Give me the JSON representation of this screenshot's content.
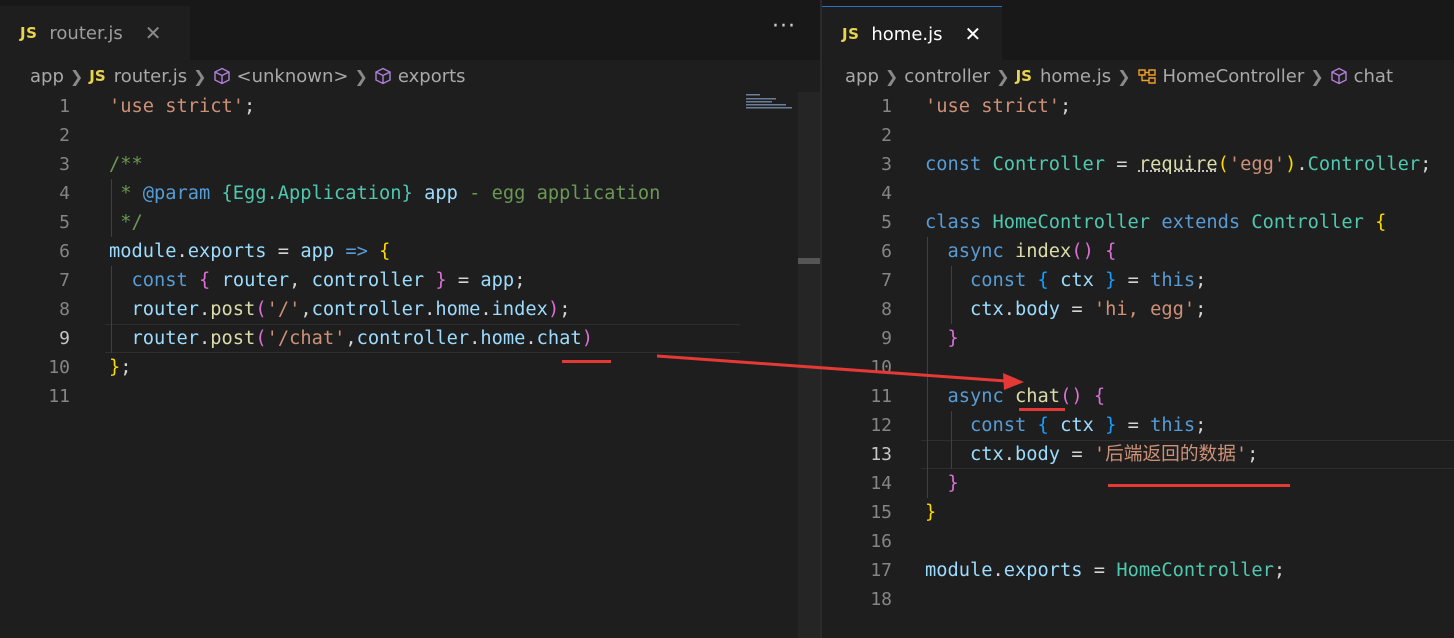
{
  "left_editor": {
    "tab": {
      "icon": "JS",
      "label": "router.js",
      "close": "✕"
    },
    "more": "···",
    "breadcrumb": [
      "app",
      "router.js",
      "<unknown>",
      "exports"
    ],
    "lines": [
      {
        "n": "1",
        "tokens": [
          [
            "str",
            "'use strict'"
          ],
          [
            "t",
            ";"
          ]
        ]
      },
      {
        "n": "2",
        "tokens": []
      },
      {
        "n": "3",
        "tokens": [
          [
            "cmt",
            "/**"
          ]
        ]
      },
      {
        "n": "4",
        "tokens": [
          [
            "cmt",
            " * "
          ],
          [
            "kw",
            "@param"
          ],
          [
            "cmt",
            " "
          ],
          [
            "cls",
            "{Egg.Application}"
          ],
          [
            "cmt",
            " "
          ],
          [
            "var",
            "app"
          ],
          [
            "cmt",
            " - egg application"
          ]
        ]
      },
      {
        "n": "5",
        "tokens": [
          [
            "cmt",
            " */"
          ]
        ]
      },
      {
        "n": "6",
        "tokens": [
          [
            "var",
            "module"
          ],
          [
            "t",
            "."
          ],
          [
            "var",
            "exports"
          ],
          [
            "t",
            " = "
          ],
          [
            "var",
            "app"
          ],
          [
            "t",
            " "
          ],
          [
            "kw",
            "=>"
          ],
          [
            "t",
            " "
          ],
          [
            "b1",
            "{"
          ]
        ]
      },
      {
        "n": "7",
        "tokens": [
          [
            "t",
            "  "
          ],
          [
            "kw",
            "const"
          ],
          [
            "t",
            " "
          ],
          [
            "b2",
            "{"
          ],
          [
            "t",
            " "
          ],
          [
            "var",
            "router"
          ],
          [
            "t",
            ", "
          ],
          [
            "var",
            "controller"
          ],
          [
            "t",
            " "
          ],
          [
            "b2",
            "}"
          ],
          [
            "t",
            " = "
          ],
          [
            "var",
            "app"
          ],
          [
            "t",
            ";"
          ]
        ]
      },
      {
        "n": "8",
        "tokens": [
          [
            "t",
            "  "
          ],
          [
            "var",
            "router"
          ],
          [
            "t",
            "."
          ],
          [
            "fn",
            "post"
          ],
          [
            "b2",
            "("
          ],
          [
            "str",
            "'/'"
          ],
          [
            "t",
            ","
          ],
          [
            "var",
            "controller"
          ],
          [
            "t",
            "."
          ],
          [
            "var",
            "home"
          ],
          [
            "t",
            "."
          ],
          [
            "var",
            "index"
          ],
          [
            "b2",
            ")"
          ],
          [
            "t",
            ";"
          ]
        ]
      },
      {
        "n": "9",
        "tokens": [
          [
            "t",
            "  "
          ],
          [
            "var",
            "router"
          ],
          [
            "t",
            "."
          ],
          [
            "fn",
            "post"
          ],
          [
            "b2",
            "("
          ],
          [
            "str",
            "'/chat'"
          ],
          [
            "t",
            ","
          ],
          [
            "var",
            "controller"
          ],
          [
            "t",
            "."
          ],
          [
            "var",
            "home"
          ],
          [
            "t",
            "."
          ],
          [
            "var",
            "chat"
          ],
          [
            "b2",
            ")"
          ]
        ]
      },
      {
        "n": "10",
        "tokens": [
          [
            "b1",
            "}"
          ],
          [
            "t",
            ";"
          ]
        ]
      },
      {
        "n": "11",
        "tokens": []
      }
    ],
    "current_line": "9"
  },
  "right_editor": {
    "tab": {
      "icon": "JS",
      "label": "home.js",
      "close": "✕"
    },
    "breadcrumb": [
      "app",
      "controller",
      "home.js",
      "HomeController",
      "chat"
    ],
    "lines": [
      {
        "n": "1",
        "tokens": [
          [
            "str",
            "'use strict'"
          ],
          [
            "t",
            ";"
          ]
        ]
      },
      {
        "n": "2",
        "tokens": []
      },
      {
        "n": "3",
        "tokens": [
          [
            "kw",
            "const"
          ],
          [
            "t",
            " "
          ],
          [
            "cls",
            "Controller"
          ],
          [
            "t",
            " = "
          ],
          [
            "fnsq",
            "require"
          ],
          [
            "b1",
            "("
          ],
          [
            "str",
            "'egg'"
          ],
          [
            "b1",
            ")"
          ],
          [
            "t",
            "."
          ],
          [
            "cls",
            "Controller"
          ],
          [
            "t",
            ";"
          ]
        ]
      },
      {
        "n": "4",
        "tokens": []
      },
      {
        "n": "5",
        "tokens": [
          [
            "kw",
            "class"
          ],
          [
            "t",
            " "
          ],
          [
            "cls",
            "HomeController"
          ],
          [
            "t",
            " "
          ],
          [
            "kw",
            "extends"
          ],
          [
            "t",
            " "
          ],
          [
            "cls",
            "Controller"
          ],
          [
            "t",
            " "
          ],
          [
            "b1",
            "{"
          ]
        ]
      },
      {
        "n": "6",
        "tokens": [
          [
            "t",
            "  "
          ],
          [
            "kw",
            "async"
          ],
          [
            "t",
            " "
          ],
          [
            "fn",
            "index"
          ],
          [
            "b2",
            "()"
          ],
          [
            "t",
            " "
          ],
          [
            "b2",
            "{"
          ]
        ]
      },
      {
        "n": "7",
        "tokens": [
          [
            "t",
            "    "
          ],
          [
            "kw",
            "const"
          ],
          [
            "t",
            " "
          ],
          [
            "b3",
            "{"
          ],
          [
            "t",
            " "
          ],
          [
            "var",
            "ctx"
          ],
          [
            "t",
            " "
          ],
          [
            "b3",
            "}"
          ],
          [
            "t",
            " = "
          ],
          [
            "kw",
            "this"
          ],
          [
            "t",
            ";"
          ]
        ]
      },
      {
        "n": "8",
        "tokens": [
          [
            "t",
            "    "
          ],
          [
            "var",
            "ctx"
          ],
          [
            "t",
            "."
          ],
          [
            "var",
            "body"
          ],
          [
            "t",
            " = "
          ],
          [
            "str",
            "'hi, egg'"
          ],
          [
            "t",
            ";"
          ]
        ]
      },
      {
        "n": "9",
        "tokens": [
          [
            "t",
            "  "
          ],
          [
            "b2",
            "}"
          ]
        ]
      },
      {
        "n": "10",
        "tokens": []
      },
      {
        "n": "11",
        "tokens": [
          [
            "t",
            "  "
          ],
          [
            "kw",
            "async"
          ],
          [
            "t",
            " "
          ],
          [
            "fn",
            "chat"
          ],
          [
            "b2",
            "()"
          ],
          [
            "t",
            " "
          ],
          [
            "b2",
            "{"
          ]
        ]
      },
      {
        "n": "12",
        "tokens": [
          [
            "t",
            "    "
          ],
          [
            "kw",
            "const"
          ],
          [
            "t",
            " "
          ],
          [
            "b3",
            "{"
          ],
          [
            "t",
            " "
          ],
          [
            "var",
            "ctx"
          ],
          [
            "t",
            " "
          ],
          [
            "b3",
            "}"
          ],
          [
            "t",
            " = "
          ],
          [
            "kw",
            "this"
          ],
          [
            "t",
            ";"
          ]
        ]
      },
      {
        "n": "13",
        "tokens": [
          [
            "t",
            "    "
          ],
          [
            "var",
            "ctx"
          ],
          [
            "t",
            "."
          ],
          [
            "var",
            "body"
          ],
          [
            "t",
            " = "
          ],
          [
            "str",
            "'后端返回的数据'"
          ],
          [
            "t",
            ";"
          ]
        ]
      },
      {
        "n": "14",
        "tokens": [
          [
            "t",
            "  "
          ],
          [
            "b2",
            "}"
          ]
        ]
      },
      {
        "n": "15",
        "tokens": [
          [
            "b1",
            "}"
          ]
        ]
      },
      {
        "n": "16",
        "tokens": []
      },
      {
        "n": "17",
        "tokens": [
          [
            "var",
            "module"
          ],
          [
            "t",
            "."
          ],
          [
            "var",
            "exports"
          ],
          [
            "t",
            " = "
          ],
          [
            "cls",
            "HomeController"
          ],
          [
            "t",
            ";"
          ]
        ]
      },
      {
        "n": "18",
        "tokens": []
      }
    ],
    "current_line": "13"
  },
  "colors": {
    "keyword": "#569cd6",
    "string": "#ce9178",
    "comment": "#6a9955",
    "variable": "#9cdcfe",
    "function": "#dcdcaa",
    "class": "#4ec9b0",
    "annotation": "#e53935",
    "js_badge": "#e8d44d"
  },
  "icons": [
    "close-icon",
    "more-actions-icon",
    "chevron-right-icon",
    "symbol-cube-icon",
    "class-icon",
    "js-file-icon"
  ]
}
